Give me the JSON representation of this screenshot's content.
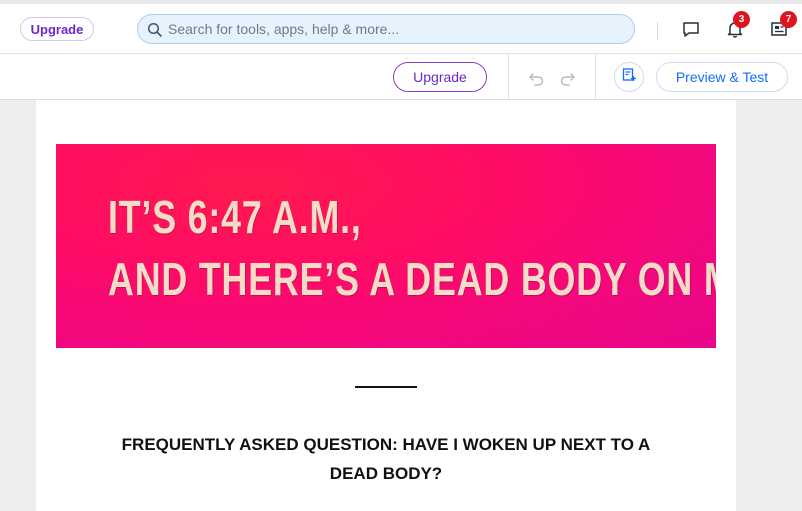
{
  "topbar": {
    "upgrade_label": "Upgrade",
    "search_placeholder": "Search for tools, apps, help & more...",
    "notifications_count": "3",
    "updates_count": "7"
  },
  "toolbar": {
    "upgrade_label": "Upgrade",
    "preview_label": "Preview & Test"
  },
  "content": {
    "banner_line1": "IT’S 6:47 A.M.,",
    "banner_line2": "AND THERE’S A DEAD BODY ON MY BED",
    "faq_heading": "FREQUENTLY ASKED QUESTION: HAVE I WOKEN UP NEXT TO A DEAD BODY?"
  },
  "colors": {
    "accent_purple": "#6b27c9",
    "accent_blue": "#116dff",
    "badge_red": "#e0141e",
    "banner_pink": "#f5087a"
  },
  "icons": [
    "search-icon",
    "chat-icon",
    "bell-icon",
    "news-icon",
    "undo-icon",
    "redo-icon",
    "page-add-icon"
  ]
}
